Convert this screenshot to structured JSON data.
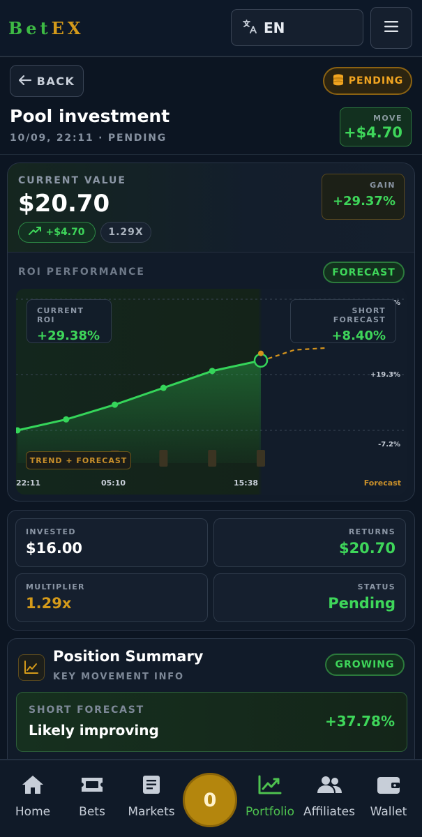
{
  "header": {
    "logo_part1": "Bet",
    "logo_part2": "EX",
    "language": "EN",
    "icons": {
      "language": "translate-icon",
      "menu": "hamburger-menu-icon"
    }
  },
  "page": {
    "back_label": "BACK",
    "status_badge": "PENDING",
    "title": "Pool investment",
    "subtitle": "10/09, 22:11 · PENDING",
    "move_label": "MOVE",
    "move_value": "+$4.70"
  },
  "current": {
    "label": "CURRENT VALUE",
    "value": "$20.70",
    "change": "+$4.70",
    "multiplier": "1.29X",
    "gain_label": "GAIN",
    "gain_value": "+29.37%"
  },
  "roi": {
    "label": "ROI PERFORMANCE",
    "forecast_badge": "FORECAST",
    "current_roi_label": "CURRENT ROI",
    "current_roi_value": "+29.38%",
    "short_forecast_label": "SHORT FORECAST",
    "short_forecast_value": "+8.40%",
    "trend_tag": "TREND + FORECAST",
    "forecast_axis_label": "Forecast"
  },
  "chart_data": {
    "type": "line",
    "x": [
      "22:11",
      "",
      "",
      "",
      "",
      "",
      "15:38"
    ],
    "x_tick_labels": [
      "22:11",
      "05:10",
      "15:38"
    ],
    "y_tick_labels": [
      "%",
      "+19.3%",
      "-7.2%"
    ],
    "series": [
      {
        "values": [
          -7.2,
          -2.0,
          5.0,
          13.0,
          21.0,
          26.0
        ]
      },
      {
        "values": [
          29.38,
          31.0,
          32.0
        ]
      }
    ],
    "grid": true,
    "colors": {
      "trend": "#35d55a",
      "forecast": "#d4931d"
    }
  },
  "stats": {
    "invested_label": "INVESTED",
    "invested_value": "$16.00",
    "returns_label": "RETURNS",
    "returns_value": "$20.70",
    "multiplier_label": "MULTIPLIER",
    "multiplier_value": "1.29x",
    "status_label": "STATUS",
    "status_value": "Pending"
  },
  "summary": {
    "title": "Position Summary",
    "subtitle": "KEY MOVEMENT INFO",
    "badge": "GROWING",
    "forecast_label": "SHORT FORECAST",
    "forecast_text": "Likely improving",
    "forecast_value": "+37.78%"
  },
  "nav": {
    "items": [
      {
        "label": "Home",
        "icon": "home-icon"
      },
      {
        "label": "Bets",
        "icon": "ticket-icon"
      },
      {
        "label": "Markets",
        "icon": "document-icon"
      },
      {
        "label": "Portfolio",
        "icon": "chart-line-icon"
      },
      {
        "label": "Affiliates",
        "icon": "users-icon"
      },
      {
        "label": "Wallet",
        "icon": "wallet-icon"
      }
    ],
    "fab_value": "0",
    "active": "Portfolio"
  },
  "colors": {
    "accent_green": "#3ed65a",
    "accent_gold": "#d49a1a",
    "background": "#0c1522"
  }
}
